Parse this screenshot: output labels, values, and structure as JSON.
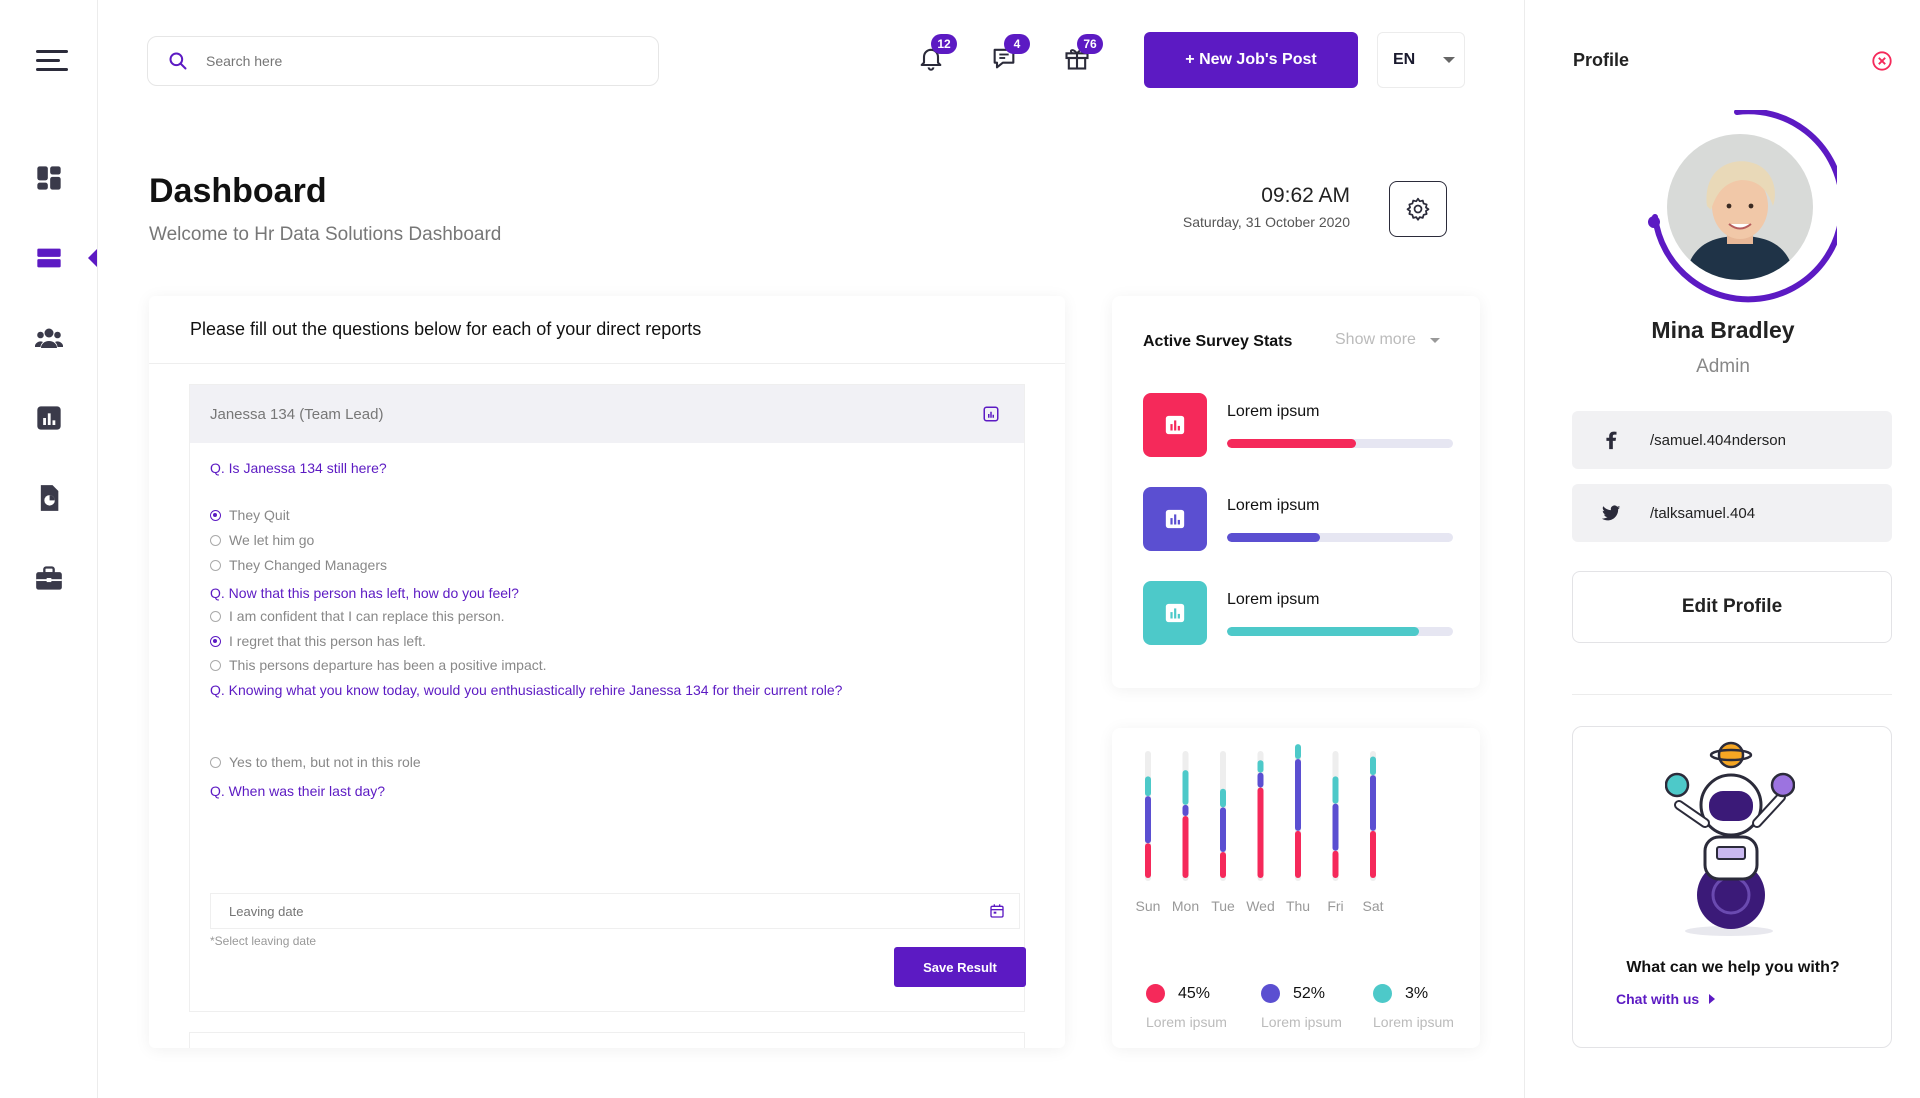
{
  "search": {
    "placeholder": "Search here"
  },
  "topbar": {
    "notifications_count": "12",
    "messages_count": "4",
    "gifts_count": "76",
    "new_job_label": "+ New Job's Post",
    "language": "EN"
  },
  "header": {
    "title": "Dashboard",
    "subtitle": "Welcome to Hr Data Solutions Dashboard",
    "time": "09:62 AM",
    "date": "Saturday, 31 October 2020"
  },
  "sidebar": {
    "items": [
      {
        "icon": "dashboard-icon",
        "active": false
      },
      {
        "icon": "list-icon",
        "active": true
      },
      {
        "icon": "users-icon",
        "active": false
      },
      {
        "icon": "bar-chart-icon",
        "active": false
      },
      {
        "icon": "report-icon",
        "active": false
      },
      {
        "icon": "briefcase-icon",
        "active": false
      }
    ]
  },
  "survey": {
    "heading": "Please fill out the questions below for each of your direct reports",
    "employee": "Janessa 134 (Team Lead)",
    "q1": "Q. Is Janessa 134 still here?",
    "q1_options": [
      "They Quit",
      "We let him go",
      "They Changed Managers"
    ],
    "q2": "Q. Now that this person has left, how do you feel?",
    "q2_options": [
      "I am confident that I can replace this person.",
      "I regret that this person has left.",
      "This persons departure has been a positive impact."
    ],
    "q3": "Q. Knowing what you know today, would you enthusiastically rehire Janessa 134 for their current role?",
    "q3_options": [
      "Yes to them, but not in this role"
    ],
    "q4": "Q. When was their last day?",
    "leaving_placeholder": "Leaving date",
    "leaving_hint": "*Select leaving date",
    "save_label": "Save Result"
  },
  "stats": {
    "title": "Active Survey Stats",
    "show_more": "Show more",
    "items": [
      {
        "label": "Lorem ipsum",
        "progress": 0.57,
        "color": "#f5295a"
      },
      {
        "label": "Lorem ipsum",
        "progress": 0.41,
        "color": "#5b4fd1"
      },
      {
        "label": "Lorem ipsum",
        "progress": 0.85,
        "color": "#4dc9c9"
      }
    ]
  },
  "chart_data": {
    "type": "bar",
    "categories": [
      "Sun",
      "Mon",
      "Tue",
      "Wed",
      "Thu",
      "Fri",
      "Sat"
    ],
    "series": [
      {
        "color": "#f5295a",
        "values": [
          28,
          50,
          21,
          73,
          38,
          22,
          38
        ]
      },
      {
        "color": "#5b4fd1",
        "values": [
          38,
          9,
          36,
          12,
          58,
          38,
          45
        ]
      },
      {
        "color": "#4dc9c9",
        "values": [
          16,
          28,
          15,
          10,
          12,
          22,
          15
        ]
      }
    ],
    "ylim": [
      0,
      100
    ],
    "legend": [
      {
        "pct": "45%",
        "name": "Lorem ipsum",
        "color": "#f5295a"
      },
      {
        "pct": "52%",
        "name": "Lorem ipsum",
        "color": "#5b4fd1"
      },
      {
        "pct": "3%",
        "name": "Lorem ipsum",
        "color": "#4dc9c9"
      }
    ]
  },
  "profile": {
    "title": "Profile",
    "name": "Mina Bradley",
    "role": "Admin",
    "facebook": "/samuel.404nderson",
    "twitter": "/talksamuel.404",
    "edit_label": "Edit Profile",
    "help_text": "What can we help you with?",
    "chat_label": "Chat with us"
  },
  "colors": {
    "accent": "#5c1ac3"
  }
}
